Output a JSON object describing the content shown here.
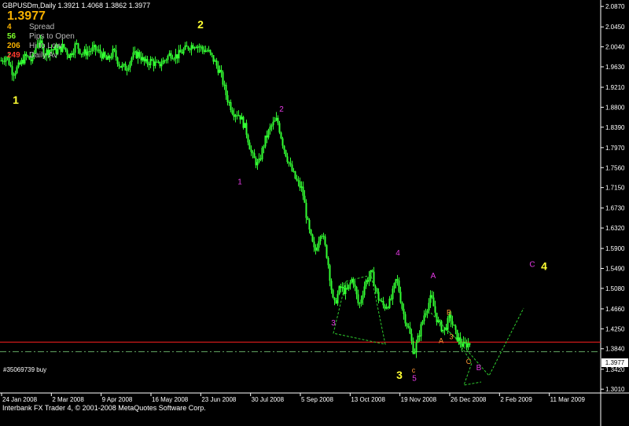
{
  "header": {
    "symbol_line": "GBPUSDm,Daily  1.3921 1.4068 1.3862 1.3977",
    "price": "1.3977"
  },
  "info_rows": [
    {
      "value": "4",
      "label": "Spread",
      "color": "#f7b100"
    },
    {
      "value": "56",
      "label": "Pips to Open",
      "color": "#7cff2a"
    },
    {
      "value": "206",
      "label": "Hi to Low",
      "color": "#f7b100"
    },
    {
      "value": "249",
      "label": "Daily Av",
      "color": "#ff3b2f"
    }
  ],
  "order_label": "#35069739 buy",
  "copyright": "Interbank FX Trader 4, © 2001-2008 MetaQuotes Software Corp.",
  "current_price_badge": "1.3977",
  "colors": {
    "background": "#000000",
    "candles": "#33ff33",
    "axis": "#ffffff",
    "bid_line": "#ff2020",
    "order_line": "#5fa05f",
    "wave_major": "#ffff33",
    "wave_minor": "#e53ae5",
    "wave_sub": "#ff9933",
    "projection": "#2ecc2e"
  },
  "chart_data": {
    "type": "candlestick",
    "symbol": "GBPUSDm",
    "timeframe": "Daily",
    "ohlc_last": {
      "open": 1.3921,
      "high": 1.4068,
      "low": 1.3862,
      "close": 1.3977
    },
    "y_ticks": [
      2.087,
      2.045,
      2.004,
      1.963,
      1.921,
      1.88,
      1.839,
      1.797,
      1.756,
      1.715,
      1.673,
      1.632,
      1.59,
      1.549,
      1.508,
      1.466,
      1.425,
      1.384,
      1.342,
      1.301
    ],
    "ylim": [
      1.2932,
      2.1002
    ],
    "x_ticks": [
      "24 Jan 2008",
      "2 Mar 2008",
      "9 Apr 2008",
      "16 May 2008",
      "23 Jun 2008",
      "30 Jul 2008",
      "5 Sep 2008",
      "13 Oct 2008",
      "19 Nov 2008",
      "26 Dec 2008",
      "2 Feb 2009",
      "11 Mar 2009"
    ],
    "bid_price": 1.3977,
    "order_price": 1.378,
    "price_path": [
      [
        0,
        1.975
      ],
      [
        8,
        1.985
      ],
      [
        16,
        1.95
      ],
      [
        24,
        1.965
      ],
      [
        32,
        1.985
      ],
      [
        40,
        1.975
      ],
      [
        48,
        2.02
      ],
      [
        56,
        1.99
      ],
      [
        64,
        2.0
      ],
      [
        72,
        1.995
      ],
      [
        80,
        2.005
      ],
      [
        88,
        1.985
      ],
      [
        96,
        2.01
      ],
      [
        104,
        1.99
      ],
      [
        112,
        1.995
      ],
      [
        120,
        2.0
      ],
      [
        128,
        1.99
      ],
      [
        136,
        1.975
      ],
      [
        144,
        1.995
      ],
      [
        152,
        1.965
      ],
      [
        160,
        1.96
      ],
      [
        168,
        1.985
      ],
      [
        176,
        1.99
      ],
      [
        184,
        1.97
      ],
      [
        192,
        1.975
      ],
      [
        200,
        1.965
      ],
      [
        208,
        1.975
      ],
      [
        216,
        1.99
      ],
      [
        224,
        1.985
      ],
      [
        232,
        1.995
      ],
      [
        240,
        2.005
      ],
      [
        248,
        2.01
      ],
      [
        256,
        2.0
      ],
      [
        264,
        1.995
      ],
      [
        272,
        1.975
      ],
      [
        280,
        1.95
      ],
      [
        288,
        1.9
      ],
      [
        296,
        1.87
      ],
      [
        304,
        1.865
      ],
      [
        312,
        1.835
      ],
      [
        320,
        1.78
      ],
      [
        328,
        1.76
      ],
      [
        336,
        1.81
      ],
      [
        344,
        1.84
      ],
      [
        352,
        1.855
      ],
      [
        360,
        1.8
      ],
      [
        368,
        1.76
      ],
      [
        376,
        1.73
      ],
      [
        384,
        1.71
      ],
      [
        392,
        1.63
      ],
      [
        400,
        1.58
      ],
      [
        408,
        1.63
      ],
      [
        416,
        1.57
      ],
      [
        424,
        1.47
      ],
      [
        432,
        1.51
      ],
      [
        440,
        1.5
      ],
      [
        448,
        1.53
      ],
      [
        456,
        1.47
      ],
      [
        464,
        1.52
      ],
      [
        472,
        1.54
      ],
      [
        480,
        1.49
      ],
      [
        488,
        1.47
      ],
      [
        496,
        1.48
      ],
      [
        504,
        1.53
      ],
      [
        512,
        1.46
      ],
      [
        520,
        1.42
      ],
      [
        526,
        1.375
      ],
      [
        532,
        1.41
      ],
      [
        540,
        1.46
      ],
      [
        548,
        1.49
      ],
      [
        556,
        1.44
      ],
      [
        564,
        1.42
      ],
      [
        572,
        1.45
      ],
      [
        580,
        1.41
      ],
      [
        588,
        1.39
      ],
      [
        596,
        1.395
      ]
    ],
    "wave_labels": [
      {
        "text": "1",
        "series": "major",
        "date_index": 20,
        "price": 1.887
      },
      {
        "text": "2",
        "series": "major",
        "date_index": 255,
        "price": 2.042
      },
      {
        "text": "3",
        "series": "major",
        "date_index": 508,
        "price": 1.322
      },
      {
        "text": "4",
        "series": "major",
        "date_index": 692,
        "price": 1.546
      },
      {
        "text": "1",
        "series": "minor",
        "date_index": 305,
        "price": 1.722
      },
      {
        "text": "2",
        "series": "minor",
        "date_index": 358,
        "price": 1.871
      },
      {
        "text": "3",
        "series": "minor",
        "date_index": 424,
        "price": 1.432
      },
      {
        "text": "4",
        "series": "minor",
        "date_index": 506,
        "price": 1.576
      },
      {
        "text": "5",
        "series": "minor",
        "date_index": 527,
        "price": 1.318
      },
      {
        "text": "A",
        "series": "minor",
        "date_index": 551,
        "price": 1.529
      },
      {
        "text": "B",
        "series": "minor",
        "date_index": 609,
        "price": 1.34
      },
      {
        "text": "C",
        "series": "minor",
        "date_index": 677,
        "price": 1.552
      },
      {
        "text": "c",
        "series": "sub",
        "date_index": 526,
        "price": 1.335
      },
      {
        "text": "B",
        "series": "sub",
        "date_index": 571,
        "price": 1.454
      },
      {
        "text": "A",
        "series": "sub",
        "date_index": 561,
        "price": 1.396
      },
      {
        "text": "3",
        "series": "sub",
        "date_index": 574,
        "price": 1.404
      },
      {
        "text": "C",
        "series": "sub",
        "date_index": 596,
        "price": 1.353
      }
    ]
  }
}
